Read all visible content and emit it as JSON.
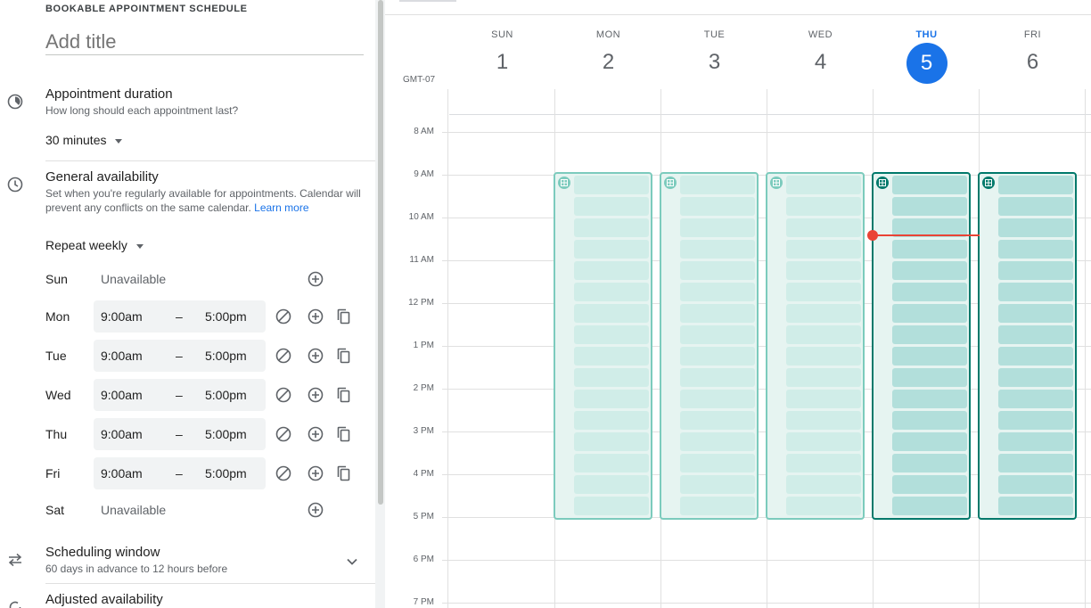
{
  "header": {
    "section_label": "BOOKABLE APPOINTMENT SCHEDULE",
    "title_placeholder": "Add title"
  },
  "duration": {
    "title": "Appointment duration",
    "subtitle": "How long should each appointment last?",
    "value": "30 minutes"
  },
  "availability": {
    "title": "General availability",
    "description": "Set when you're regularly available for appointments. Calendar will prevent any conflicts on the same calendar.",
    "learn_more": "Learn more",
    "repeat": "Repeat weekly",
    "days": [
      {
        "day": "Sun",
        "available": false,
        "status": "Unavailable"
      },
      {
        "day": "Mon",
        "available": true,
        "start": "9:00am",
        "sep": "–",
        "end": "5:00pm"
      },
      {
        "day": "Tue",
        "available": true,
        "start": "9:00am",
        "sep": "–",
        "end": "5:00pm"
      },
      {
        "day": "Wed",
        "available": true,
        "start": "9:00am",
        "sep": "–",
        "end": "5:00pm"
      },
      {
        "day": "Thu",
        "available": true,
        "start": "9:00am",
        "sep": "–",
        "end": "5:00pm"
      },
      {
        "day": "Fri",
        "available": true,
        "start": "9:00am",
        "sep": "–",
        "end": "5:00pm"
      },
      {
        "day": "Sat",
        "available": false,
        "status": "Unavailable"
      }
    ]
  },
  "scheduling_window": {
    "title": "Scheduling window",
    "subtitle": "60 days in advance to 12 hours before"
  },
  "adjusted": {
    "title": "Adjusted availability"
  },
  "calendar": {
    "timezone": "GMT-07",
    "days": [
      {
        "dow": "SUN",
        "num": "1",
        "today": false
      },
      {
        "dow": "MON",
        "num": "2",
        "today": false
      },
      {
        "dow": "TUE",
        "num": "3",
        "today": false
      },
      {
        "dow": "WED",
        "num": "4",
        "today": false
      },
      {
        "dow": "THU",
        "num": "5",
        "today": true
      },
      {
        "dow": "FRI",
        "num": "6",
        "today": false
      }
    ],
    "hours": [
      "8 AM",
      "9 AM",
      "10 AM",
      "11 AM",
      "12 PM",
      "1 PM",
      "2 PM",
      "3 PM",
      "4 PM",
      "5 PM",
      "6 PM",
      "7 PM"
    ],
    "availability_start_hour": 9,
    "availability_end_hour": 17,
    "slot_minutes": 30,
    "current_time_hour": 10.42,
    "colors": {
      "accent": "#1a73e8",
      "past_block": "#e6f4f1",
      "past_border": "#7ccbbd",
      "future_block": "#b2dfdb",
      "future_border": "#00796b",
      "now_line": "#ea4335"
    }
  }
}
